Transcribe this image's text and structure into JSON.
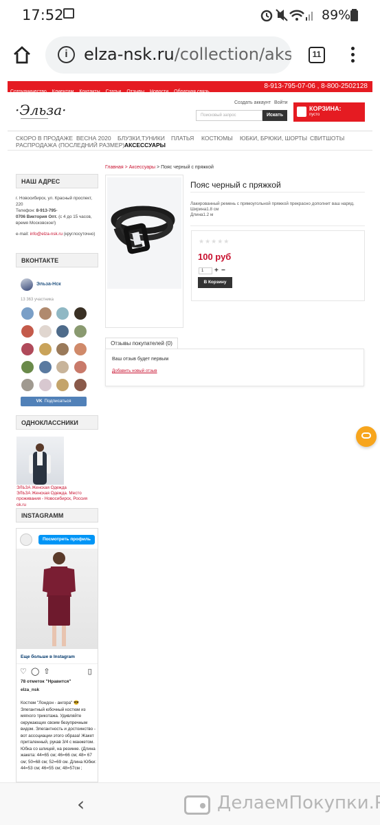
{
  "status": {
    "time": "17:52",
    "battery": "89%"
  },
  "browser": {
    "url_domain": "elza-nsk.ru",
    "url_path": "/collection/akses",
    "tab_count": "11"
  },
  "topnav": {
    "links": [
      "Сотрудничество",
      "Клиентам",
      "Контакты",
      "Статьи",
      "Отзывы",
      "Новости",
      "Обратная связь"
    ],
    "phones": "8-913-795-07-06 , 8-800-2502128"
  },
  "header": {
    "logo": "·Эльза·",
    "create_account": "Создать аккаунт",
    "login": "Войти",
    "search_placeholder": "Поисковый запрос",
    "search_button": "Искать",
    "cart_title": "КОРЗИНА:",
    "cart_status": "пусто"
  },
  "categories": {
    "row1": [
      "СКОРО В ПРОДАЖЕ",
      "ВЕСНА 2020",
      "БЛУЗКИ,ТУНИКИ",
      "ПЛАТЬЯ",
      "КОСТЮМЫ",
      "ЮБКИ, БРЮКИ, ШОРТЫ",
      "СВИТШОТЫ"
    ],
    "row2": [
      "РАСПРОДАЖА (ПОСЛЕДНИЙ РАЗМЕР)",
      "АКСЕССУАРЫ"
    ]
  },
  "sidebar": {
    "address_heading": "НАШ АДРЕС",
    "address_line1": "г. Новосибирск, ул.  Красный проспект,",
    "address_line2": "220",
    "phone_label": "Телефон:",
    "phone_value": "8-913-795-",
    "phone_line2": "0706",
    "phone_person": "Виктория  Опт.",
    "phone_hours_a": "(с 4 до 15 часов,",
    "phone_hours_b": "время Московское!)",
    "email_label": "e-mail:",
    "email_value": "info@elza-nsk.ru",
    "email_note": "(круглосуточно)",
    "vk_heading": "ВКОНТАКТЕ",
    "vk_name": "Эльза-Нск",
    "vk_count": "13 363 участника",
    "vk_button": "Подписаться",
    "ok_heading": "ОДНОКЛАССНИКИ",
    "ok_line1": "ЭЛЬЗА Женская Одежда",
    "ok_line2": "ЭЛЬЗА Женская Одежда. Место",
    "ok_line3": "проживания - Новосибирск, Россия",
    "ok_line4": "ok.ru",
    "insta_heading": "INSTAGRAMM",
    "insta_view": "Посмотреть профиль",
    "insta_more": "Еще больше в Instagram",
    "insta_likes": "78 отметок \"Нравится\"",
    "insta_user": "elza_nsk",
    "insta_caption": "Костюм \"Лондон - ангора\" 😎 Элегантный юбочный костюм из мягкого трикотажа. Удивляйте окружающих своим безупречным видом. Элегантность и достоинство - вот ассоциации этого образа! Жакет приталенный, рукав 3/4 с манжетом. Юбка со шлицей, на резинке. (Длина жакета: 44=65 см; 46=66 см; 48= 67 см; 50=68 см; 52=69 см. Длина Юбки: 44=53 см; 46=55 см; 48=57см ;"
  },
  "breadcrumb": {
    "home": "Главная",
    "sep1": " > ",
    "section": "Аксессуары",
    "sep2": " > ",
    "current": "Пояс черный с пряжкой"
  },
  "product": {
    "title": "Пояс черный с пряжкой",
    "desc1": "Лакированный ремень с прямоугольной пряжкой прекрасно дополнит ваш наряд.",
    "desc2": "Ширина1.8 см",
    "desc3": "Длина1.2 м",
    "stars": "★★★★★",
    "price": "100 руб",
    "qty": "1",
    "plus": "+",
    "minus": "−",
    "buy_button": "В Корзину"
  },
  "reviews": {
    "tab": "Отзывы покупателей (0)",
    "empty": "Ваш отзыв будет первым",
    "add_link": "Добавить новый отзыв"
  },
  "watermark": "ДелаемПокупки.Ру"
}
